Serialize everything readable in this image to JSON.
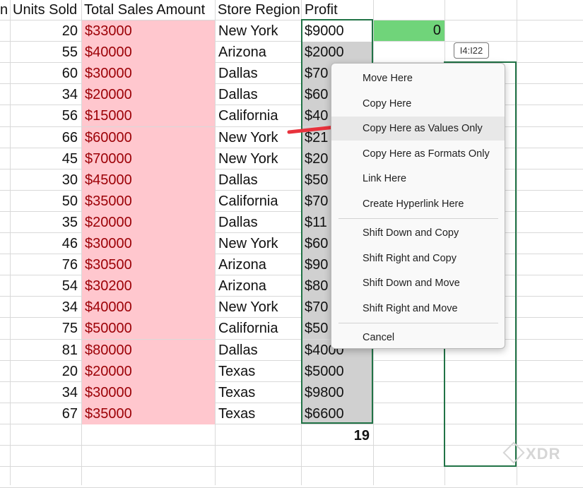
{
  "headers": {
    "partial_left": "n",
    "units_sold": "Units Sold",
    "total_sales": "Total Sales Amount",
    "store_region": "Store Region",
    "profit": "Profit"
  },
  "rows": [
    {
      "units": "20",
      "sales": "$33000",
      "region": "New York",
      "profit": "$9000"
    },
    {
      "units": "55",
      "sales": "$40000",
      "region": "Arizona",
      "profit": "$2000"
    },
    {
      "units": "60",
      "sales": "$30000",
      "region": "Dallas",
      "profit": "$70"
    },
    {
      "units": "34",
      "sales": "$20000",
      "region": "Dallas",
      "profit": "$60"
    },
    {
      "units": "56",
      "sales": "$15000",
      "region": "California",
      "profit": "$40"
    },
    {
      "units": "66",
      "sales": "$60000",
      "region": "New York",
      "profit": "$21"
    },
    {
      "units": "45",
      "sales": "$70000",
      "region": "New York",
      "profit": "$20"
    },
    {
      "units": "30",
      "sales": "$45000",
      "region": "Dallas",
      "profit": "$50"
    },
    {
      "units": "50",
      "sales": "$35000",
      "region": "California",
      "profit": "$70"
    },
    {
      "units": "35",
      "sales": "$20000",
      "region": "Dallas",
      "profit": "$11"
    },
    {
      "units": "46",
      "sales": "$30000",
      "region": "New York",
      "profit": "$60"
    },
    {
      "units": "76",
      "sales": "$30500",
      "region": "Arizona",
      "profit": "$90"
    },
    {
      "units": "54",
      "sales": "$30200",
      "region": "Arizona",
      "profit": "$80"
    },
    {
      "units": "34",
      "sales": "$40000",
      "region": "New York",
      "profit": "$70"
    },
    {
      "units": "75",
      "sales": "$50000",
      "region": "California",
      "profit": "$50"
    },
    {
      "units": "81",
      "sales": "$80000",
      "region": "Dallas",
      "profit": "$4000"
    },
    {
      "units": "20",
      "sales": "$20000",
      "region": "Texas",
      "profit": "$5000"
    },
    {
      "units": "34",
      "sales": "$30000",
      "region": "Texas",
      "profit": "$9800"
    },
    {
      "units": "67",
      "sales": "$35000",
      "region": "Texas",
      "profit": "$6600"
    }
  ],
  "green_cell_value": "0",
  "sum_value": "19",
  "range_tooltip": "I4:I22",
  "menu": {
    "groups": [
      [
        {
          "label": "Move Here",
          "highlight": false
        },
        {
          "label": "Copy Here",
          "highlight": false
        },
        {
          "label": "Copy Here as Values Only",
          "highlight": true
        },
        {
          "label": "Copy Here as Formats Only",
          "highlight": false
        },
        {
          "label": "Link Here",
          "highlight": false
        },
        {
          "label": "Create Hyperlink Here",
          "highlight": false
        }
      ],
      [
        {
          "label": "Shift Down and Copy",
          "highlight": false
        },
        {
          "label": "Shift Right and Copy",
          "highlight": false
        },
        {
          "label": "Shift Down and Move",
          "highlight": false
        },
        {
          "label": "Shift Right and Move",
          "highlight": false
        }
      ],
      [
        {
          "label": "Cancel",
          "highlight": false
        }
      ]
    ]
  },
  "watermark": "XDR",
  "colors": {
    "sales_fill": "#ffc7ce",
    "sales_text": "#9c0006",
    "profit_fill": "#d0d0d0",
    "selection_border": "#217346",
    "green_fill": "#70d47a",
    "arrow": "#e8323c"
  }
}
